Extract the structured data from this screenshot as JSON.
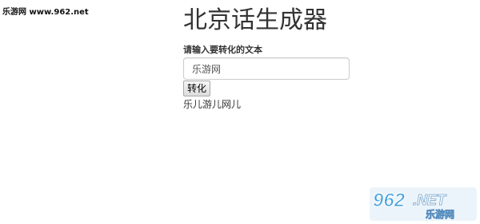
{
  "watermark": {
    "text": "乐游网 www.962.net"
  },
  "page": {
    "title": "北京话生成器",
    "input_label": "请输入要转化的文本",
    "input_value": "乐游网",
    "convert_button_label": "转化",
    "result_text": "乐儿游儿网儿"
  },
  "logo": {
    "number": "962",
    "suffix": ".NET",
    "name": "乐游网",
    "colors": {
      "number": "#4aa3df",
      "suffix": "#ffffff",
      "background": "#e9f2fa"
    }
  }
}
